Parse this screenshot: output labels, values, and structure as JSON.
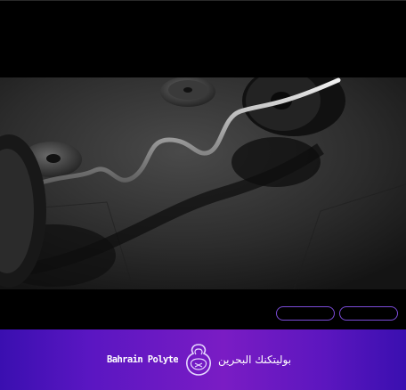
{
  "hero": {
    "image": "gym-barbell-photo"
  },
  "buttons": [
    {
      "label": ""
    },
    {
      "label": ""
    }
  ],
  "footer": {
    "brand_en": "Bahrain Polytechnic",
    "brand_ar": "بوليتكنك البحرين",
    "logo": "bahrain-polytechnic-logo"
  },
  "colors": {
    "background": "#000000",
    "button_border": "#7b4bd8",
    "footer_gradient_start": "#3a0fb0",
    "footer_gradient_mid": "#7a1cc4"
  }
}
